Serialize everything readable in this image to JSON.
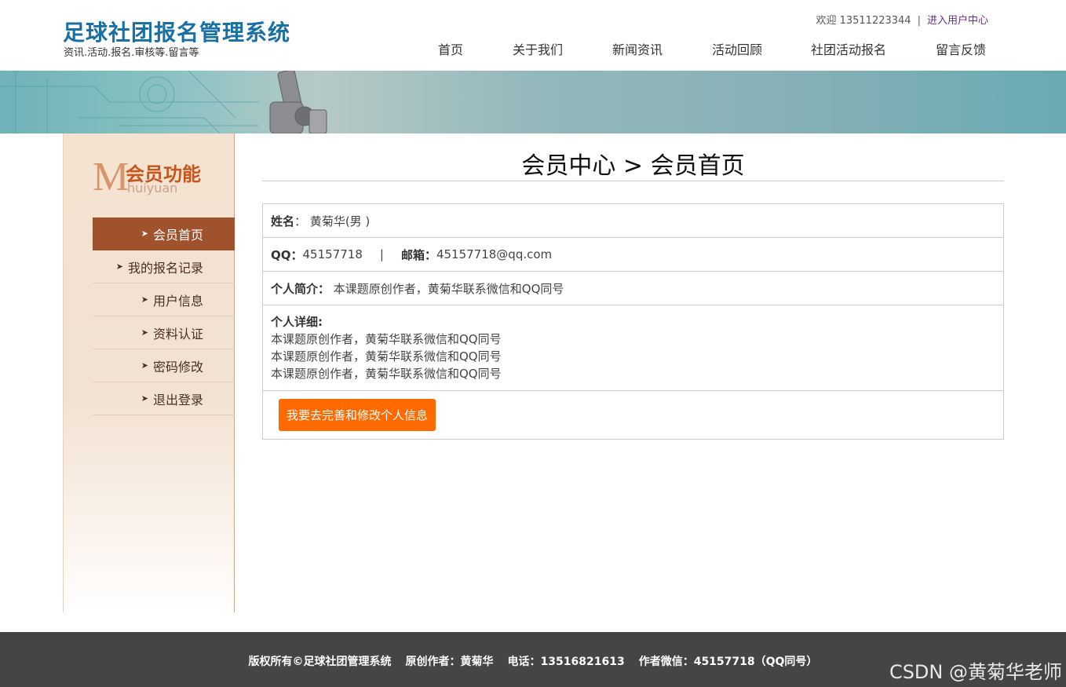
{
  "header": {
    "site_title": "足球社团报名管理系统",
    "site_subtitle": "资讯.活动.报名.审核等.留言等",
    "welcome_text": "欢迎 13511223344",
    "separator": "|",
    "user_center_link": "进入用户中心",
    "nav": [
      "首页",
      "关于我们",
      "新闻资讯",
      "活动回顾",
      "社团活动报名",
      "留言反馈"
    ]
  },
  "sidebar": {
    "logo_letter": "M",
    "logo_title": "会员功能",
    "logo_pinyin": "huiyuan",
    "arrow_glyph": "➤",
    "items": [
      {
        "label": "会员首页",
        "active": true
      },
      {
        "label": "我的报名记录",
        "active": false
      },
      {
        "label": "用户信息",
        "active": false
      },
      {
        "label": "资料认证",
        "active": false
      },
      {
        "label": "密码修改",
        "active": false
      },
      {
        "label": "退出登录",
        "active": false
      }
    ]
  },
  "main": {
    "title": "会员中心 > 会员首页",
    "name_label": "姓名",
    "name_colon": "：",
    "name_value": "黄菊华(男 )",
    "qq_label": "QQ：",
    "qq_value": "45157718",
    "pipe": "|",
    "email_label": "邮箱：",
    "email_value": "45157718@qq.com",
    "intro_label": "个人简介：",
    "intro_value": "本课题原创作者，黄菊华联系微信和QQ同号",
    "detail_label": "个人详细:",
    "detail_lines": [
      "本课题原创作者，黄菊华联系微信和QQ同号",
      "本课题原创作者，黄菊华联系微信和QQ同号",
      "本课题原创作者，黄菊华联系微信和QQ同号"
    ],
    "edit_button": "我要去完善和修改个人信息"
  },
  "footer": {
    "copyright": "版权所有©足球社团管理系统",
    "author": "原创作者：黄菊华",
    "phone": "电话：13516821613",
    "wechat": "作者微信：45157718（QQ同号）",
    "watermark": "CSDN @黄菊华老师"
  },
  "colors": {
    "title_blue": "#1a6fa3",
    "active_brown": "#a0522d",
    "button_orange": "#ff6a00",
    "footer_gray": "#454545"
  }
}
